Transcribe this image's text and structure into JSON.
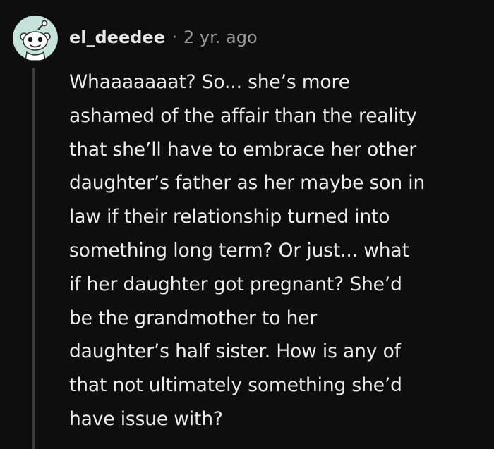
{
  "comment": {
    "author": "el_deedee",
    "separator": "·",
    "timestamp": "2 yr. ago",
    "avatar_icon": "snoo-avatar-icon",
    "colors": {
      "background": "#0e0e0e",
      "avatar_bg": "#c5e3da",
      "text": "#ececec",
      "meta": "#9a9a9a",
      "thread_line": "#3a3a3a"
    },
    "body_lines": [
      "Whaaaaaaat? So... she’s more",
      "ashamed of the affair than the reality",
      "that she’ll have to embrace her other",
      "daughter’s father as her maybe son in",
      "law if their relationship turned into",
      "something long term? Or just... what",
      "if her daughter got pregnant? She’d",
      "be the grandmother to her",
      "daughter’s half sister. How is any of",
      "that not ultimately something she’d",
      "have issue with?"
    ]
  }
}
